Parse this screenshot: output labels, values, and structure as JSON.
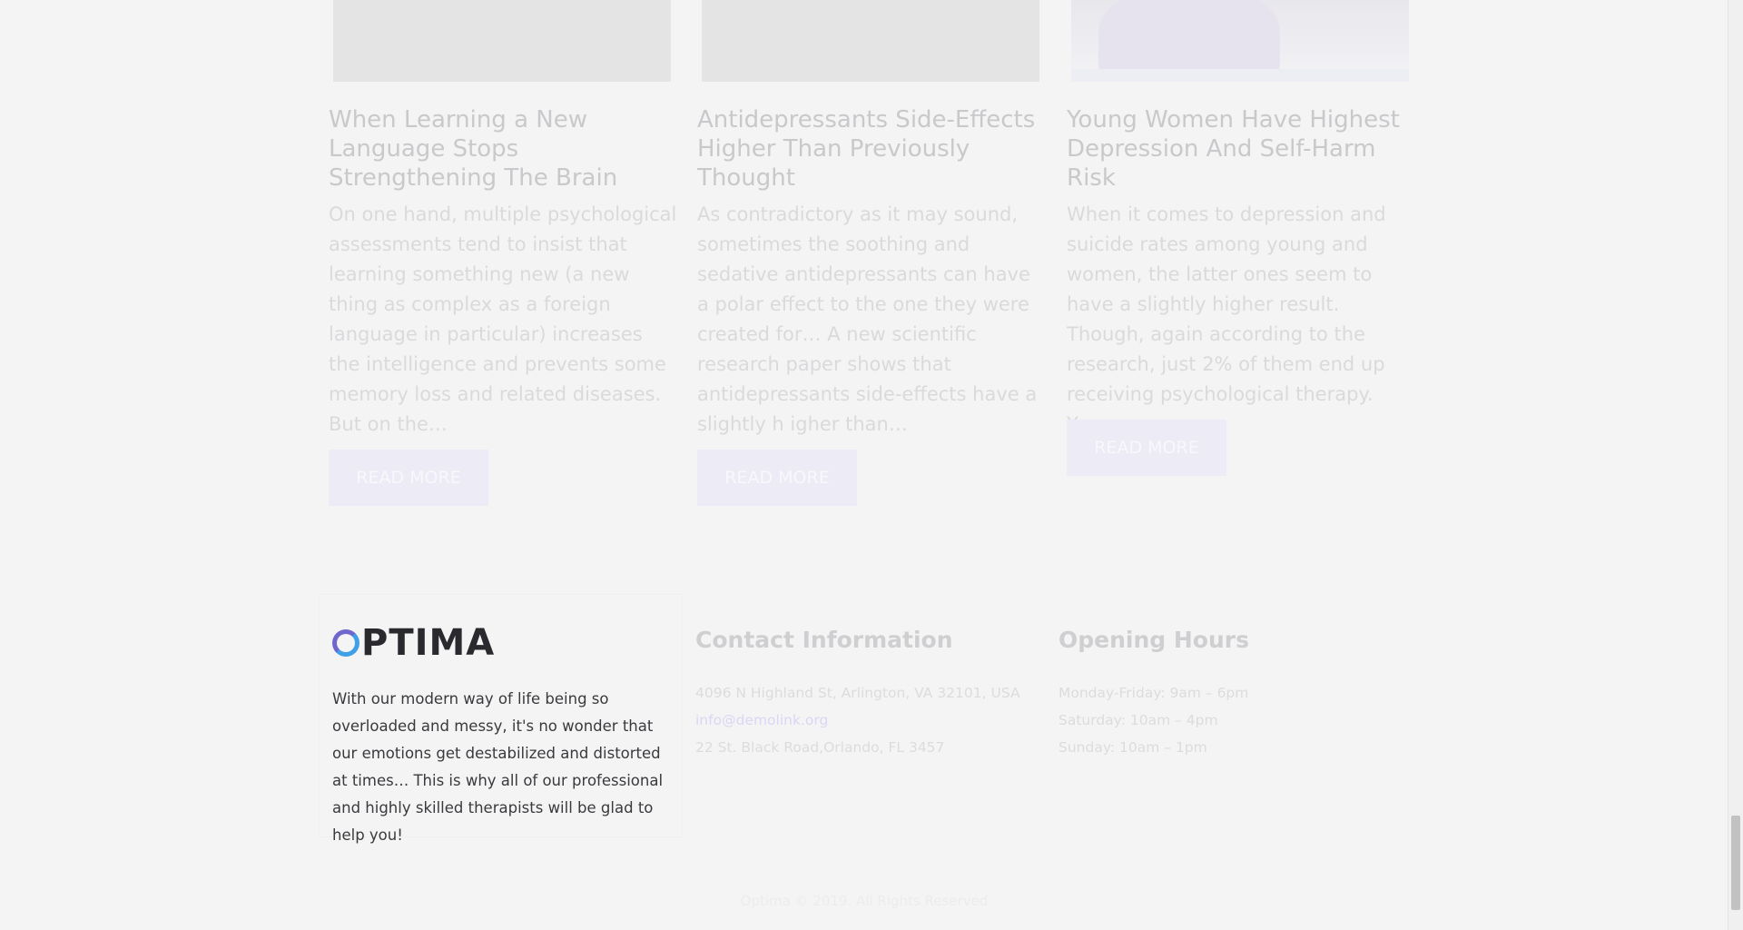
{
  "posts": [
    {
      "title": "When Learning a New Language Stops Strengthening The Brain",
      "excerpt": "    On one hand, multiple psychological assessments tend to insist that learning something new (a new thing as complex as a foreign language in particular) increases the intelligence and prevents some memory loss and related diseases. But on the…",
      "button": "READ MORE"
    },
    {
      "title": "Antidepressants Side-Effects Higher Than Previously Thought",
      "excerpt": "  As contradictory as it may sound, sometimes the soothing and sedative antidepressants can have a polar effect to the one they were created for… A new scientific research paper shows that antidepressants side-effects have a slightly h igher than…",
      "button": "READ MORE"
    },
    {
      "title": "Young Women Have Highest Depression And Self-Harm Risk",
      "excerpt": "  When it comes to depression and suicide rates among young  and women, the latter ones seem to have a slightly higher result. Though, again according to the research, just 2% of them end up receiving psychological therapy.  Young women…",
      "button": "READ MORE"
    }
  ],
  "footer": {
    "logo_text": "PTIMA",
    "about": "With our modern way of life being so overloaded and messy, it's no wonder that our emotions get destabilized and distorted at times… This is why all of our professional and highly skilled therapists will be glad to help you!",
    "contact": {
      "title": "Contact Information",
      "address": "4096 N Highland St, Arlington, VA 32101, USA",
      "email": "info@demolink.org",
      "address2": "22 St. Black Road,Orlando, FL 3457"
    },
    "hours": {
      "title": "Opening Hours",
      "weekdays": "Monday-Friday: 9am – 6pm",
      "saturday": "Saturday: 10am – 4pm",
      "sunday": "Sunday: 10am – 1pm"
    },
    "copyright": "Optima © 2019. All Rights Reserved"
  },
  "colors": {
    "logo_ring_primary": "#6f66ce",
    "logo_ring_secondary": "#3fa0e8",
    "button_bg": "#ecebf6"
  },
  "icons": {
    "logo_mark": "ring-logo-icon"
  }
}
